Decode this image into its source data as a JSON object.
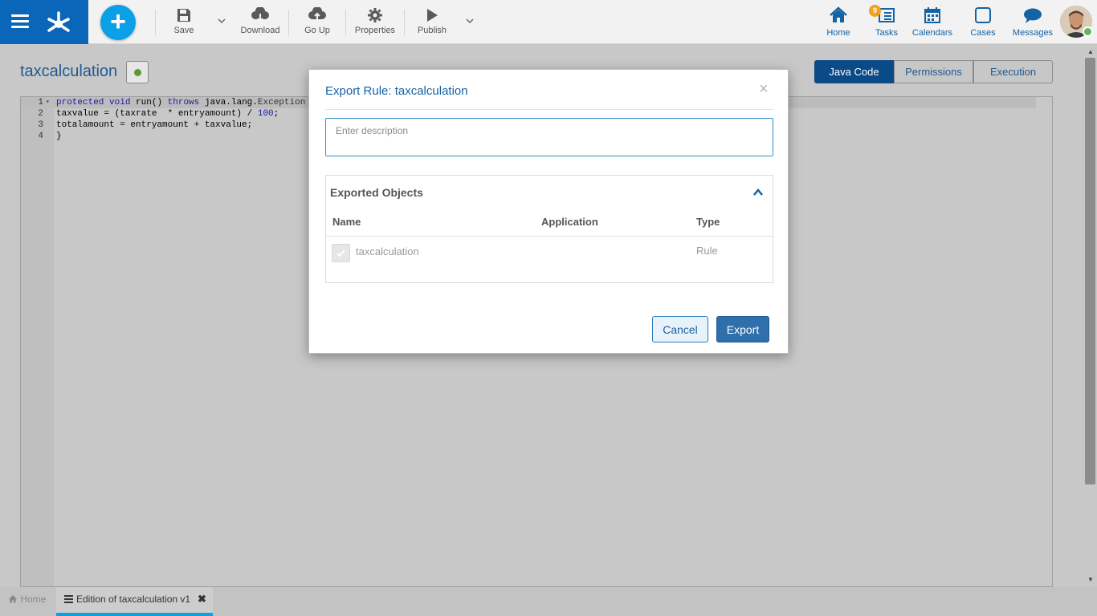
{
  "topbar": {
    "toolbar": {
      "save": "Save",
      "download": "Download",
      "go_up": "Go Up",
      "properties": "Properties",
      "publish": "Publish"
    },
    "nav": {
      "home": "Home",
      "tasks": "Tasks",
      "tasks_badge": "9",
      "calendars": "Calendars",
      "cases": "Cases",
      "messages": "Messages"
    }
  },
  "page": {
    "title": "taxcalculation",
    "status_color": "#5b9a2f",
    "tabs": [
      "Java Code",
      "Permissions",
      "Execution"
    ],
    "active_tab": "Java Code"
  },
  "code": {
    "lines": [
      {
        "num": "1",
        "parts": [
          [
            "kw",
            "protected"
          ],
          [
            "t",
            " "
          ],
          [
            "kw",
            "void"
          ],
          [
            "t",
            " run() "
          ],
          [
            "kw",
            "throws"
          ],
          [
            "t",
            " java.lang."
          ],
          [
            "cls",
            "Exception"
          ]
        ]
      },
      {
        "num": "2",
        "parts": [
          [
            "t",
            "taxvalue = (taxrate  * entryamount) / "
          ],
          [
            "num",
            "100"
          ],
          [
            "t",
            ";"
          ]
        ]
      },
      {
        "num": "3",
        "parts": [
          [
            "t",
            "totalamount = entryamount + taxvalue;"
          ]
        ]
      },
      {
        "num": "4",
        "parts": [
          [
            "t",
            "}"
          ]
        ]
      }
    ]
  },
  "bottom_tabs": {
    "home": "Home",
    "edit": "Edition of taxcalculation v1"
  },
  "modal": {
    "title": "Export Rule: taxcalculation",
    "description_placeholder": "Enter description",
    "panel_title": "Exported Objects",
    "columns": {
      "name": "Name",
      "application": "Application",
      "type": "Type"
    },
    "row": {
      "name": "taxcalculation",
      "application": "",
      "type": "Rule",
      "checked": true
    },
    "cancel": "Cancel",
    "export": "Export"
  }
}
